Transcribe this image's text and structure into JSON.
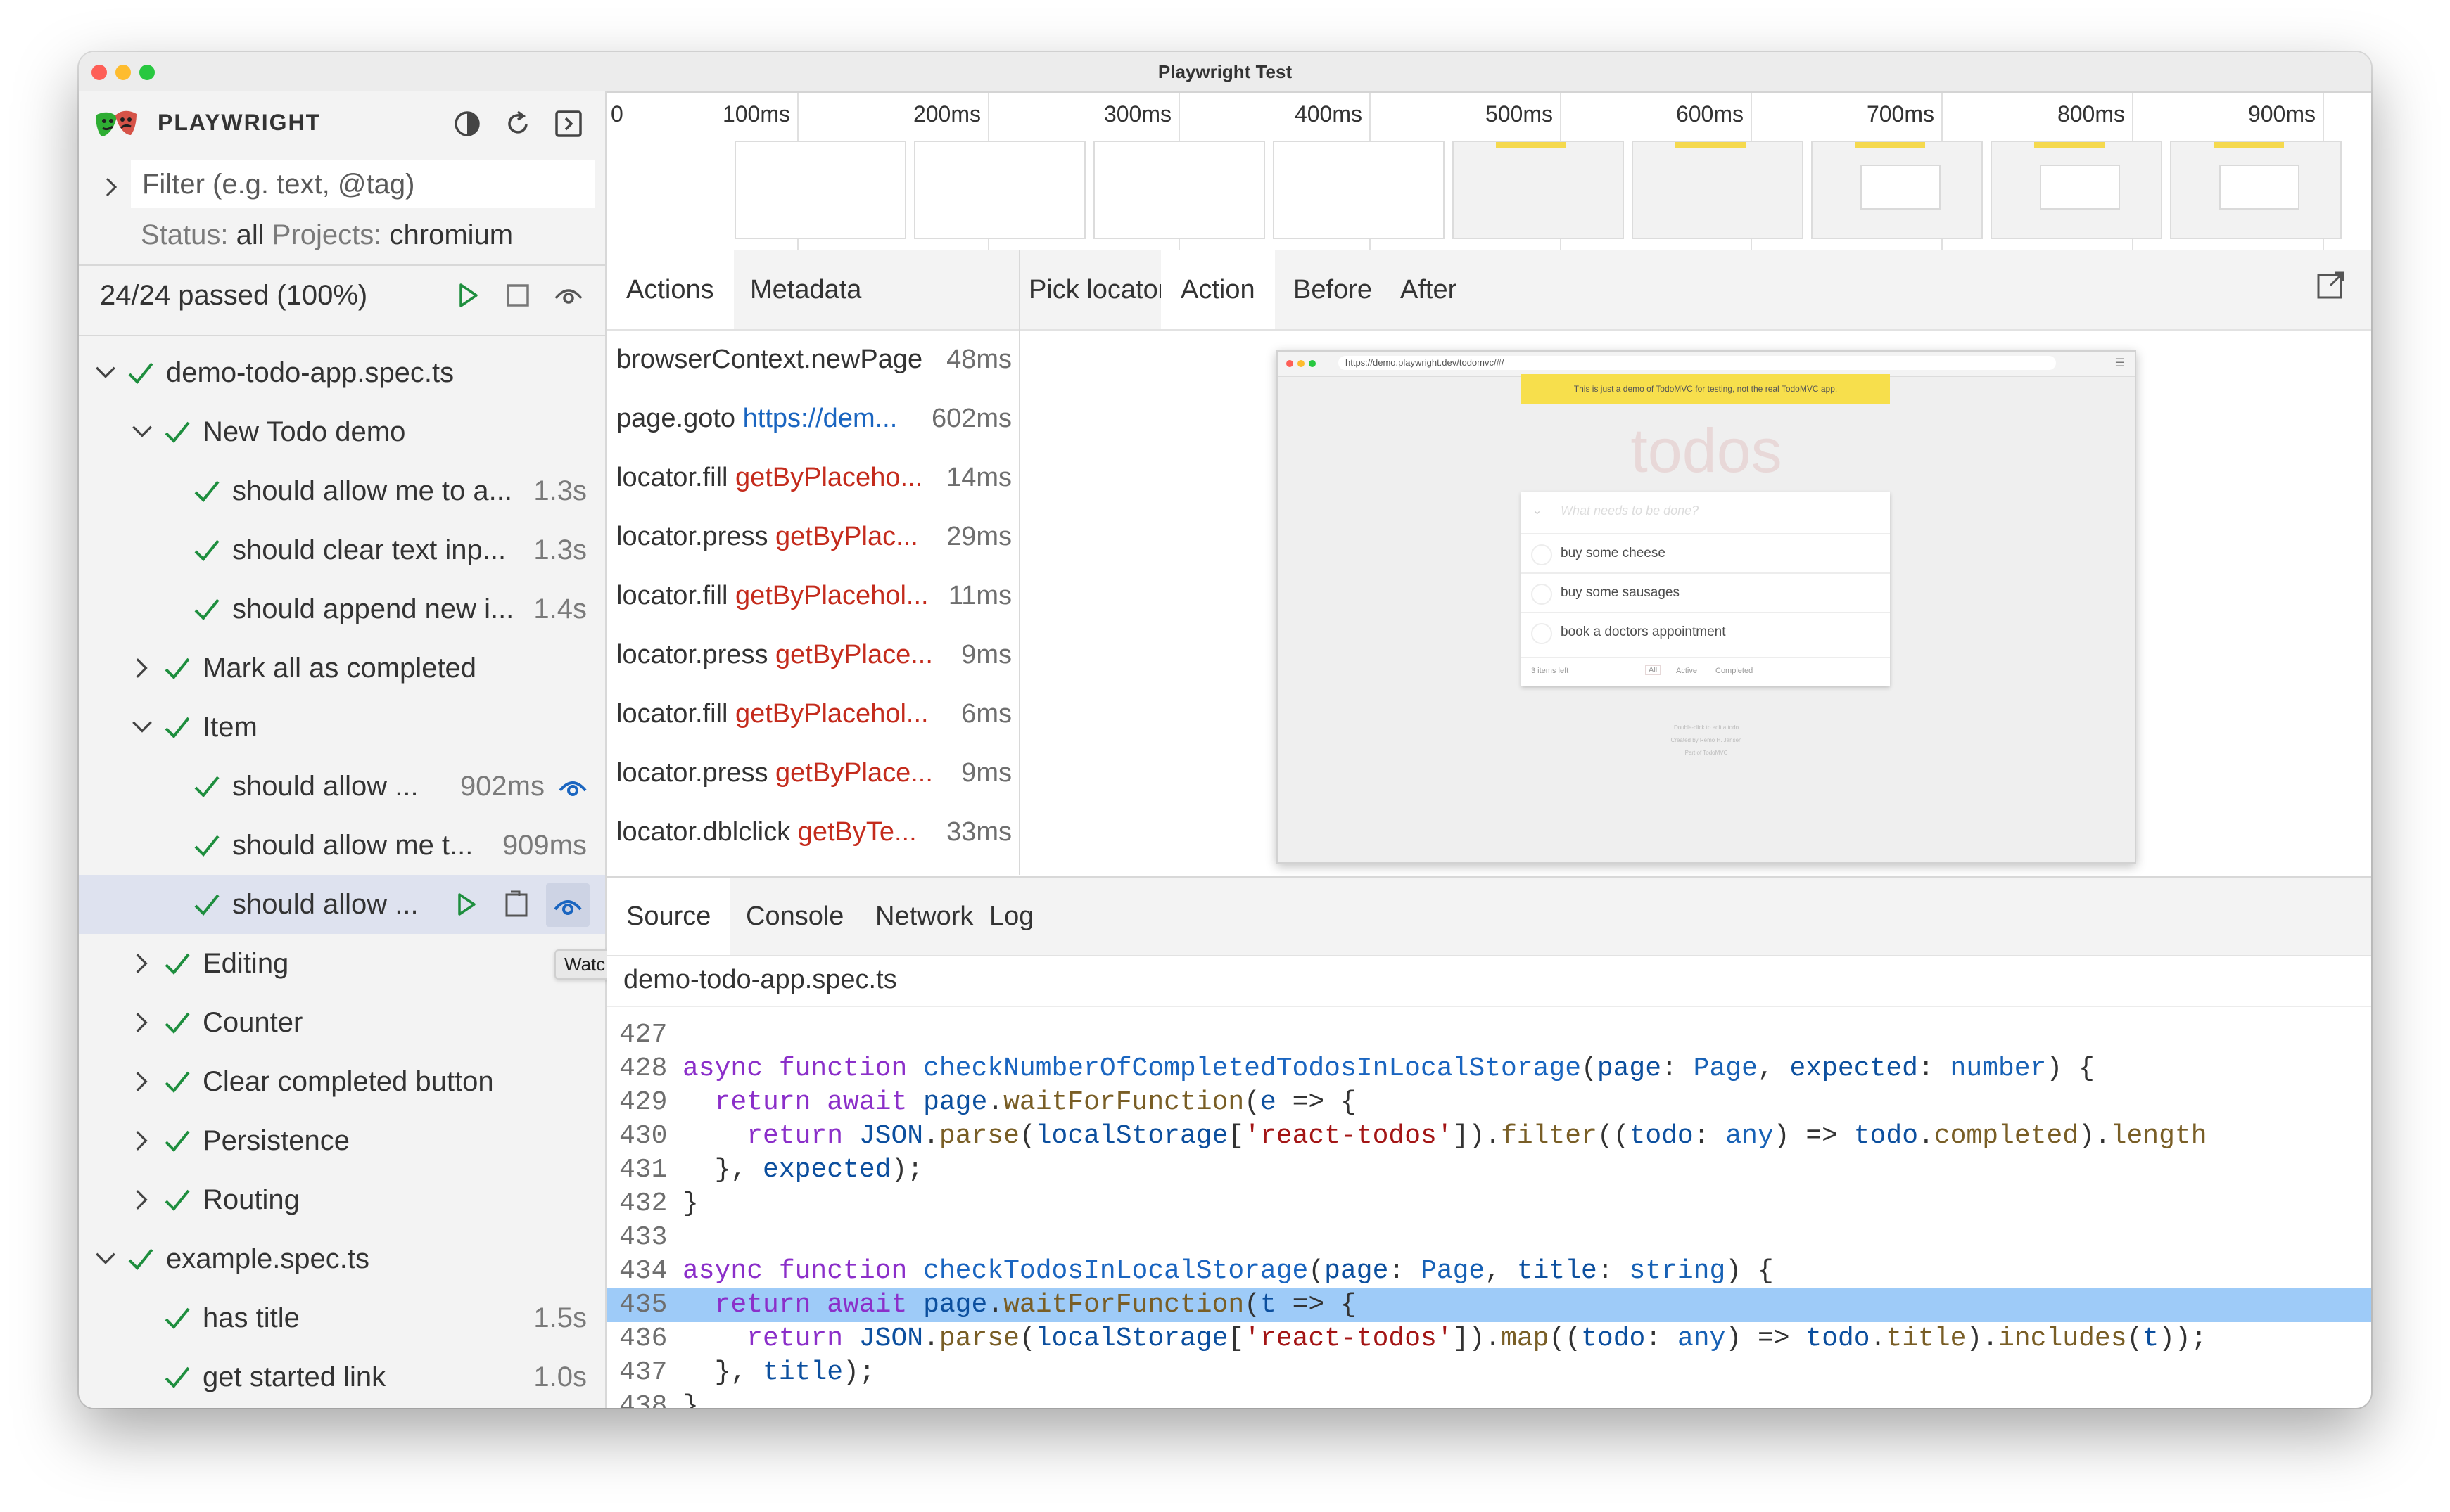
{
  "window": {
    "title": "Playwright Test"
  },
  "sidebar": {
    "brand": "PLAYWRIGHT",
    "filter_placeholder": "Filter (e.g. text, @tag)",
    "status_label": "Status:",
    "status_value": "all",
    "projects_label": "Projects:",
    "projects_value": "chromium",
    "passed_summary": "24/24 passed (100%)",
    "tree": [
      {
        "label": "demo-todo-app.spec.ts",
        "duration": "",
        "level": 0,
        "expanded": true
      },
      {
        "label": "New Todo demo",
        "duration": "",
        "level": 1,
        "expanded": true
      },
      {
        "label": "should allow me to a...",
        "duration": "1.3s",
        "level": 2
      },
      {
        "label": "should clear text inp...",
        "duration": "1.3s",
        "level": 2
      },
      {
        "label": "should append new i...",
        "duration": "1.4s",
        "level": 2
      },
      {
        "label": "Mark all as completed",
        "duration": "",
        "level": 1,
        "expanded": false
      },
      {
        "label": "Item",
        "duration": "",
        "level": 1,
        "expanded": true
      },
      {
        "label": "should allow ...",
        "duration": "902ms",
        "level": 2,
        "watched": true
      },
      {
        "label": "should allow me t...",
        "duration": "909ms",
        "level": 2
      },
      {
        "label": "should allow ...",
        "duration": "",
        "level": 2,
        "selected": true
      },
      {
        "label": "Editing",
        "duration": "",
        "level": 1,
        "expanded": false
      },
      {
        "label": "Counter",
        "duration": "",
        "level": 1,
        "expanded": false
      },
      {
        "label": "Clear completed button",
        "duration": "",
        "level": 1,
        "expanded": false
      },
      {
        "label": "Persistence",
        "duration": "",
        "level": 1,
        "expanded": false
      },
      {
        "label": "Routing",
        "duration": "",
        "level": 1,
        "expanded": false
      },
      {
        "label": "example.spec.ts",
        "duration": "",
        "level": 0,
        "expanded": true
      },
      {
        "label": "has title",
        "duration": "1.5s",
        "level": 1
      },
      {
        "label": "get started link",
        "duration": "1.0s",
        "level": 1
      }
    ],
    "tooltip": "Watch"
  },
  "timeline": {
    "ticks": [
      "0",
      "100ms",
      "200ms",
      "300ms",
      "400ms",
      "500ms",
      "600ms",
      "700ms",
      "800ms",
      "900ms"
    ]
  },
  "actions_panel": {
    "tabs": [
      "Actions",
      "Metadata"
    ],
    "active_tab": "Actions",
    "actions": [
      {
        "name": "browserContext.newPage",
        "arg": "",
        "arg_type": "",
        "duration": "48ms"
      },
      {
        "name": "page.goto",
        "arg": "https://dem...",
        "arg_type": "url",
        "duration": "602ms"
      },
      {
        "name": "locator.fill",
        "arg": "getByPlaceho...",
        "arg_type": "selector",
        "duration": "14ms"
      },
      {
        "name": "locator.press",
        "arg": "getByPlac...",
        "arg_type": "selector",
        "duration": "29ms"
      },
      {
        "name": "locator.fill",
        "arg": "getByPlacehol...",
        "arg_type": "selector",
        "duration": "11ms"
      },
      {
        "name": "locator.press",
        "arg": "getByPlace...",
        "arg_type": "selector",
        "duration": "9ms"
      },
      {
        "name": "locator.fill",
        "arg": "getByPlacehol...",
        "arg_type": "selector",
        "duration": "6ms"
      },
      {
        "name": "locator.press",
        "arg": "getByPlace...",
        "arg_type": "selector",
        "duration": "9ms"
      },
      {
        "name": "locator.dblclick",
        "arg": "getByTe...",
        "arg_type": "selector",
        "duration": "33ms"
      }
    ]
  },
  "snapshot_panel": {
    "tabs": [
      "Pick locator",
      "Action",
      "Before",
      "After"
    ],
    "active_tab": "Action",
    "browser": {
      "url": "https://demo.playwright.dev/todomvc/#/",
      "banner": "This is just a demo of TodoMVC for testing, not the real TodoMVC app.",
      "heading": "todos",
      "input_placeholder": "What needs to be done?",
      "items": [
        "buy some cheese",
        "buy some sausages",
        "book a doctors appointment"
      ],
      "footer_count": "3 items left",
      "footer_filters": [
        "All",
        "Active",
        "Completed"
      ],
      "info": [
        "Double-click to edit a todo",
        "Created by Remo H. Jansen",
        "Part of TodoMVC"
      ]
    }
  },
  "bottom_panel": {
    "tabs": [
      "Source",
      "Console",
      "Network",
      "Log"
    ],
    "active_tab": "Source",
    "file": "demo-todo-app.spec.ts",
    "highlight_line": "435",
    "lines": [
      {
        "n": "427",
        "tokens": []
      },
      {
        "n": "428",
        "tokens": [
          [
            "kw",
            "async "
          ],
          [
            "kw",
            "function "
          ],
          [
            "fn",
            "checkNumberOfCompletedTodosInLocalStorage"
          ],
          [
            "",
            "("
          ],
          [
            "vr",
            "page"
          ],
          [
            "",
            ": "
          ],
          [
            "ty",
            "Page"
          ],
          [
            "",
            ", "
          ],
          [
            "vr",
            "expected"
          ],
          [
            "",
            ": "
          ],
          [
            "ty",
            "number"
          ],
          [
            "",
            ") {"
          ]
        ]
      },
      {
        "n": "429",
        "tokens": [
          [
            "",
            "  "
          ],
          [
            "kw",
            "return "
          ],
          [
            "kw",
            "await "
          ],
          [
            "vr",
            "page"
          ],
          [
            "",
            "."
          ],
          [
            "mt",
            "waitForFunction"
          ],
          [
            "",
            "("
          ],
          [
            "vr",
            "e"
          ],
          [
            "",
            " => {"
          ]
        ]
      },
      {
        "n": "430",
        "tokens": [
          [
            "",
            "    "
          ],
          [
            "kw",
            "return "
          ],
          [
            "vr",
            "JSON"
          ],
          [
            "",
            "."
          ],
          [
            "mt",
            "parse"
          ],
          [
            "",
            "("
          ],
          [
            "vr",
            "localStorage"
          ],
          [
            "",
            "["
          ],
          [
            "st",
            "'react-todos'"
          ],
          [
            "",
            "])."
          ],
          [
            "mt",
            "filter"
          ],
          [
            "",
            "(("
          ],
          [
            "vr",
            "todo"
          ],
          [
            "",
            ": "
          ],
          [
            "ty",
            "any"
          ],
          [
            "",
            ") => "
          ],
          [
            "vr",
            "todo"
          ],
          [
            "",
            "."
          ],
          [
            "mt",
            "completed"
          ],
          [
            "",
            ")."
          ],
          [
            "mt",
            "length"
          ]
        ]
      },
      {
        "n": "431",
        "tokens": [
          [
            "",
            "  }, "
          ],
          [
            "vr",
            "expected"
          ],
          [
            "",
            ");"
          ]
        ]
      },
      {
        "n": "432",
        "tokens": [
          [
            "",
            "}"
          ]
        ]
      },
      {
        "n": "433",
        "tokens": []
      },
      {
        "n": "434",
        "tokens": [
          [
            "kw",
            "async "
          ],
          [
            "kw",
            "function "
          ],
          [
            "fn",
            "checkTodosInLocalStorage"
          ],
          [
            "",
            "("
          ],
          [
            "vr",
            "page"
          ],
          [
            "",
            ": "
          ],
          [
            "ty",
            "Page"
          ],
          [
            "",
            ", "
          ],
          [
            "vr",
            "title"
          ],
          [
            "",
            ": "
          ],
          [
            "ty",
            "string"
          ],
          [
            "",
            ") {"
          ]
        ]
      },
      {
        "n": "435",
        "tokens": [
          [
            "",
            "  "
          ],
          [
            "kw",
            "return "
          ],
          [
            "kw",
            "await "
          ],
          [
            "vr",
            "page"
          ],
          [
            "",
            "."
          ],
          [
            "mt",
            "waitForFunction"
          ],
          [
            "",
            "("
          ],
          [
            "vr",
            "t"
          ],
          [
            "",
            " => {"
          ]
        ]
      },
      {
        "n": "436",
        "tokens": [
          [
            "",
            "    "
          ],
          [
            "kw",
            "return "
          ],
          [
            "vr",
            "JSON"
          ],
          [
            "",
            "."
          ],
          [
            "mt",
            "parse"
          ],
          [
            "",
            "("
          ],
          [
            "vr",
            "localStorage"
          ],
          [
            "",
            "["
          ],
          [
            "st",
            "'react-todos'"
          ],
          [
            "",
            "])."
          ],
          [
            "mt",
            "map"
          ],
          [
            "",
            "(("
          ],
          [
            "vr",
            "todo"
          ],
          [
            "",
            ": "
          ],
          [
            "ty",
            "any"
          ],
          [
            "",
            ") => "
          ],
          [
            "vr",
            "todo"
          ],
          [
            "",
            "."
          ],
          [
            "mt",
            "title"
          ],
          [
            "",
            ")."
          ],
          [
            "mt",
            "includes"
          ],
          [
            "",
            "("
          ],
          [
            "vr",
            "t"
          ],
          [
            "",
            "));"
          ]
        ]
      },
      {
        "n": "437",
        "tokens": [
          [
            "",
            "  }, "
          ],
          [
            "vr",
            "title"
          ],
          [
            "",
            ");"
          ]
        ]
      },
      {
        "n": "438",
        "tokens": [
          [
            "",
            "}"
          ]
        ]
      }
    ]
  },
  "colors": {
    "pass_green": "#1e8e3e",
    "selector_red": "#c42b1c",
    "link_blue": "#1a65c0",
    "highlight": "#9ecbf8",
    "selected_row": "#dee2ef"
  }
}
